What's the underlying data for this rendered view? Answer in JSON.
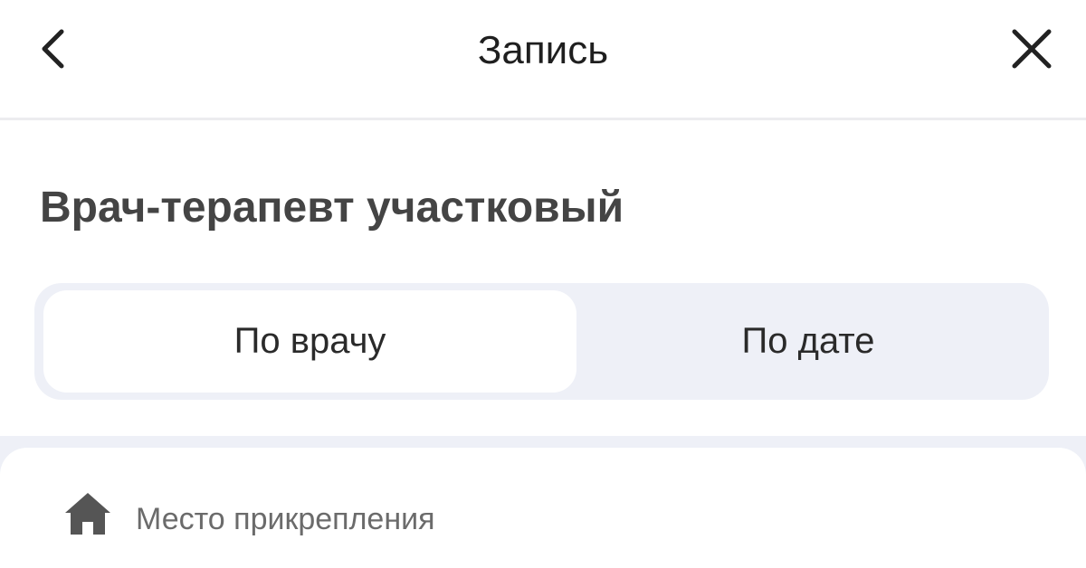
{
  "header": {
    "title": "Запись",
    "back_icon": "chevron-left-icon",
    "close_icon": "close-icon"
  },
  "specialty": {
    "title": "Врач-терапевт участковый"
  },
  "tabs": [
    {
      "label": "По врачу",
      "selected": true
    },
    {
      "label": "По дате",
      "selected": false
    }
  ],
  "info": {
    "icon": "home-icon",
    "label": "Место прикрепления"
  },
  "colors": {
    "segment_bg": "#eef0f7",
    "text_dark": "#2b2b2b",
    "text_muted": "#6b6b6b",
    "heading": "#444444"
  }
}
